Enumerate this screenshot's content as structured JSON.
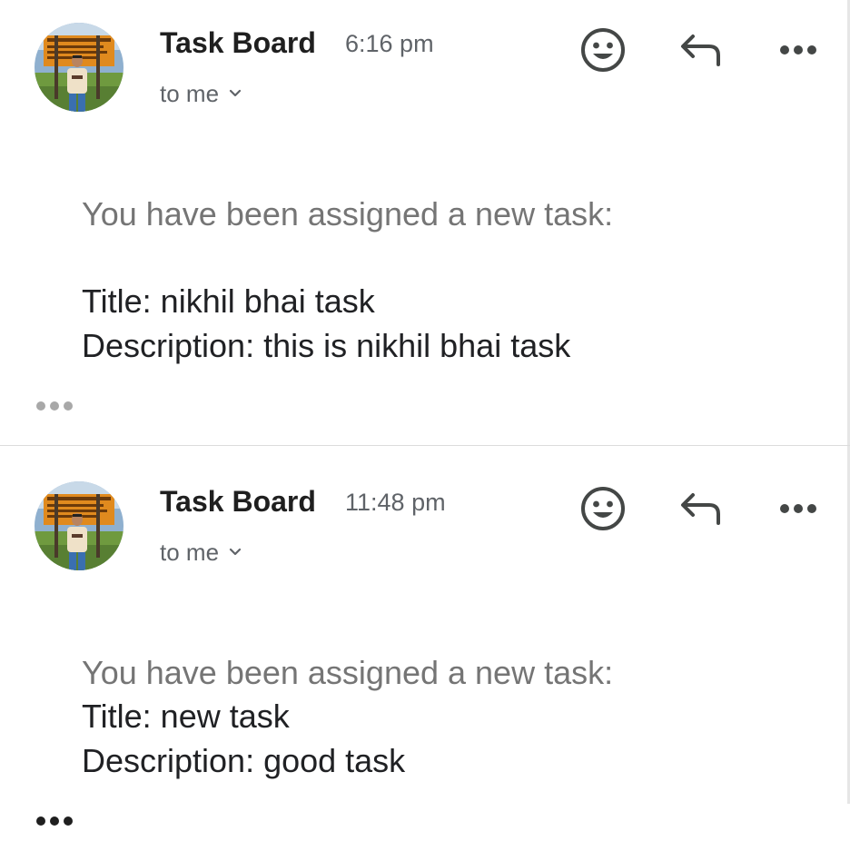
{
  "messages": [
    {
      "sender": "Task Board",
      "time": "6:16 pm",
      "recipient": "to me",
      "intro": "You have been assigned a new task:",
      "title_line": "Title: nikhil bhai task",
      "description_line": "Description: this is nikhil bhai task",
      "avatar_icon": "profile-photo-avatar"
    },
    {
      "sender": "Task Board",
      "time": "11:48 pm",
      "recipient": "to me",
      "intro": "You have been assigned a new task:",
      "title_line": "Title: new task",
      "description_line": "Description: good task",
      "avatar_icon": "profile-photo-avatar"
    }
  ],
  "icons": {
    "emoji": "smiley-face-icon",
    "reply": "reply-arrow-icon",
    "more": "more-horizontal-icon",
    "expand": "chevron-down-icon",
    "trimmed": "ellipsis-icon"
  },
  "colors": {
    "sender_text": "#1f1f1f",
    "meta_text": "#5f6368",
    "intro_text": "#757575",
    "body_text": "#202124",
    "divider": "#dcdcdc"
  }
}
